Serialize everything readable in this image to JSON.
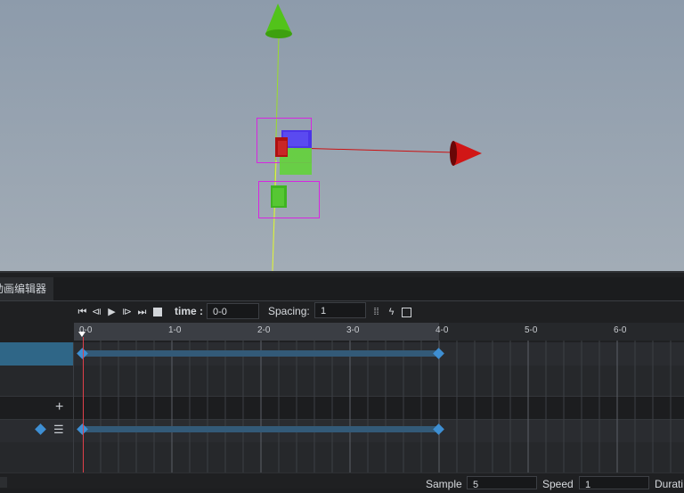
{
  "panel": {
    "tab_title": "动画编辑器"
  },
  "toolbar": {
    "icons": [
      "jump-start-icon",
      "prev-frame-icon",
      "play-icon",
      "next-frame-icon",
      "jump-end-icon",
      "stop-icon",
      "grid-snap-icon",
      "lightning-icon",
      "save-icon"
    ],
    "time_label": "time :",
    "time_value": "0-0",
    "spacing_label": "Spacing:",
    "spacing_value": "1"
  },
  "ruler": {
    "ticks": [
      "0-0",
      "1-0",
      "2-0",
      "3-0",
      "4-0",
      "5-0",
      "6-0"
    ]
  },
  "tracks": {
    "add_symbol": "+",
    "list_symbol": "☰"
  },
  "footer": {
    "sample_label": "Sample",
    "sample_value": "5",
    "speed_label": "Speed",
    "speed_value": "1",
    "duration_label": "Durati"
  },
  "colors": {
    "selected_row": "#2f6687",
    "keyframe": "#3e8fd3",
    "playhead": "#e0404a",
    "track_bar": "#335a78"
  }
}
